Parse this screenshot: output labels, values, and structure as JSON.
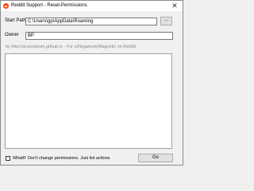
{
  "window": {
    "title": "Reddit Support - Reset-Permissions",
    "close_glyph": "✕",
    "icon": "reddit-logo-icon",
    "accent_color": "#ff4500"
  },
  "form": {
    "start_path_label": "Start Path",
    "start_path_value": "C:\\Users\\gp\\AppData\\Roaming",
    "browse_label": "...",
    "owner_label": "Owner",
    "owner_value": "BP"
  },
  "credit_text": "by http://arsscriptum.github.io - For u/NegativelyMagnetic on Reddit",
  "footer": {
    "whatif_label": "WhatIf: Don't change permissions. Just list actions",
    "whatif_checked": false,
    "go_label": "Go"
  }
}
